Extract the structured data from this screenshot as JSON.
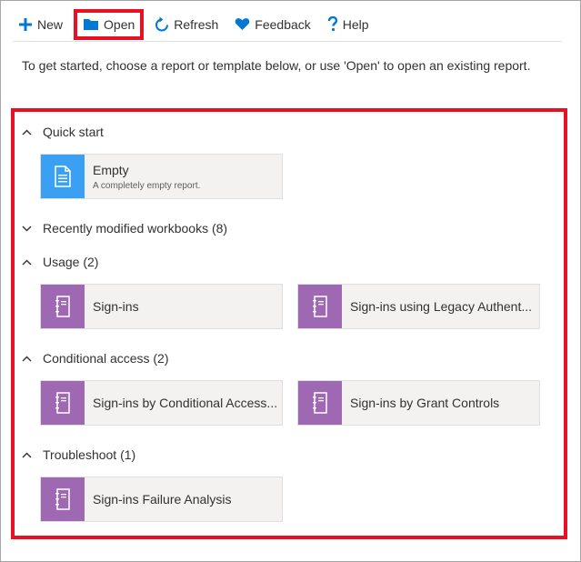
{
  "toolbar": {
    "new_label": "New",
    "open_label": "Open",
    "refresh_label": "Refresh",
    "feedback_label": "Feedback",
    "help_label": "Help"
  },
  "intro_text": "To get started, choose a report or template below, or use 'Open' to open an existing report.",
  "sections": {
    "quick_start": {
      "title": "Quick start",
      "tiles": [
        {
          "title": "Empty",
          "subtitle": "A completely empty report."
        }
      ]
    },
    "recent": {
      "title": "Recently modified workbooks (8)"
    },
    "usage": {
      "title": "Usage (2)",
      "tiles": [
        {
          "title": "Sign-ins"
        },
        {
          "title": "Sign-ins using Legacy Authent..."
        }
      ]
    },
    "conditional": {
      "title": "Conditional access (2)",
      "tiles": [
        {
          "title": "Sign-ins by Conditional Access..."
        },
        {
          "title": "Sign-ins by Grant Controls"
        }
      ]
    },
    "troubleshoot": {
      "title": "Troubleshoot (1)",
      "tiles": [
        {
          "title": "Sign-ins Failure Analysis"
        }
      ]
    }
  },
  "colors": {
    "accent_blue": "#0078d4",
    "highlight_red": "#e81123",
    "tile_blue": "#3aa0f3",
    "tile_purple": "#9e69b2",
    "tile_bg": "#f3f2f1"
  }
}
